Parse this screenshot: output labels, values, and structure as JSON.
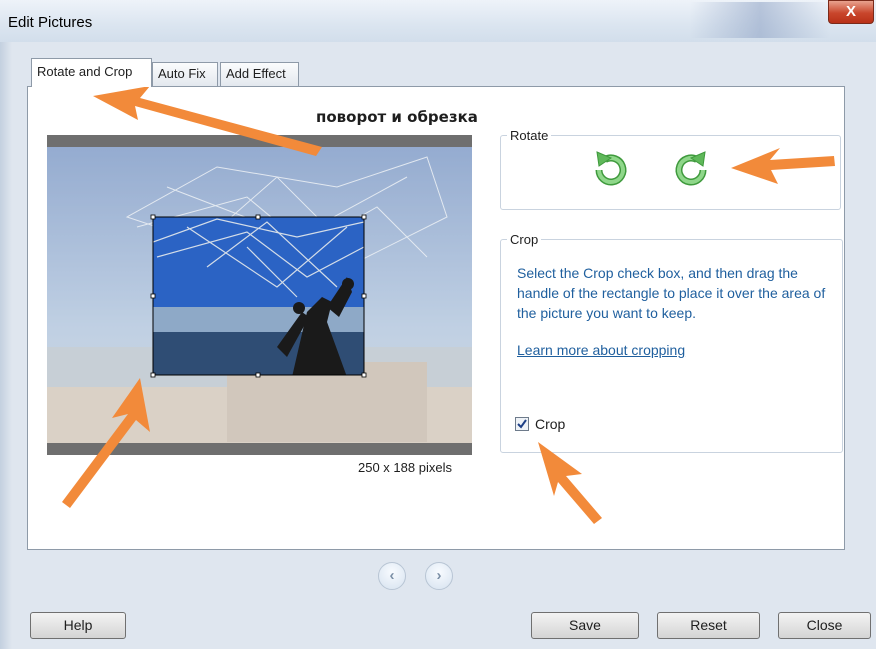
{
  "window": {
    "title": "Edit Pictures",
    "close_glyph": "X"
  },
  "tabs": [
    {
      "label": "Rotate and Crop",
      "active": true
    },
    {
      "label": "Auto Fix",
      "active": false
    },
    {
      "label": "Add Effect",
      "active": false
    }
  ],
  "annotation_text": "поворот и обрезка",
  "photo": {
    "size_label": "250 x 188 pixels"
  },
  "rotate": {
    "group_label": "Rotate"
  },
  "crop": {
    "group_label": "Crop",
    "description": "Select the Crop check box, and then drag the handle of the rectangle to place it over the area of the picture you want to keep.",
    "link": "Learn more about cropping",
    "checkbox_label": "Crop",
    "checked": true
  },
  "buttons": {
    "help": "Help",
    "save": "Save",
    "reset": "Reset",
    "close": "Close"
  },
  "colors": {
    "accent_link": "#1f5f9e",
    "rotate_arrow": "#5fb85a",
    "annotation_arrow": "#f28a3a"
  }
}
